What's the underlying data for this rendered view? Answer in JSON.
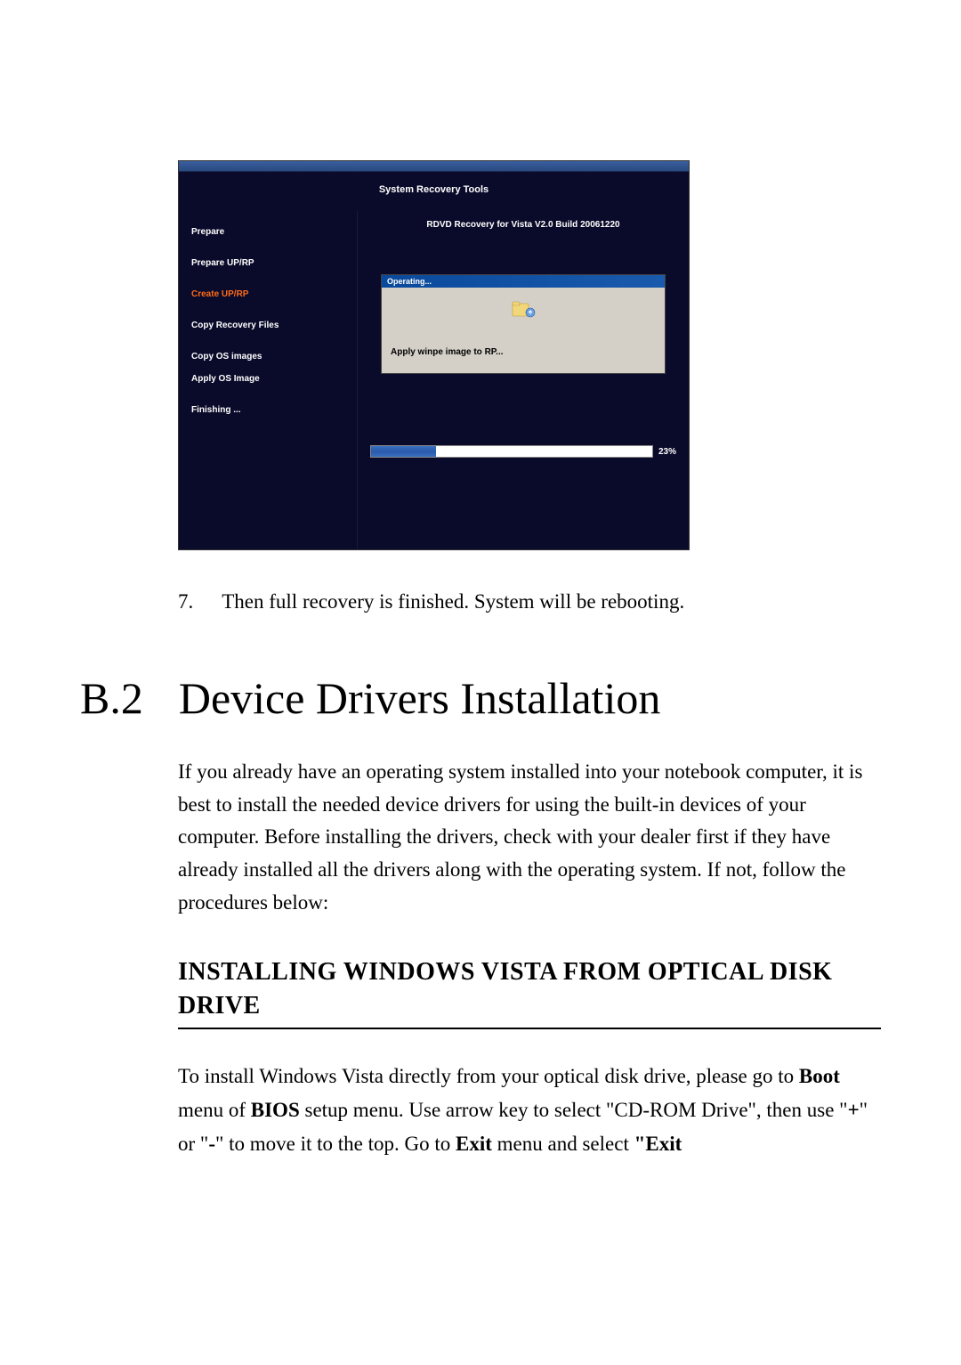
{
  "screenshot": {
    "window_title": "System Recovery Tools",
    "main_title": "RDVD Recovery for Vista V2.0 Build 20061220",
    "sidebar_steps": [
      {
        "label": "Prepare",
        "active": false
      },
      {
        "label": "Prepare UP/RP",
        "active": false
      },
      {
        "label": "Create UP/RP",
        "active": true
      },
      {
        "label": "Copy Recovery Files",
        "active": false
      },
      {
        "label": "Copy OS images",
        "active": false
      },
      {
        "label": "Apply OS Image",
        "active": false
      },
      {
        "label": "Finishing ...",
        "active": false
      }
    ],
    "dialog": {
      "title": "Operating...",
      "message": "Apply winpe image to RP..."
    },
    "progress_pct_label": "23%",
    "progress_value": 23
  },
  "step": {
    "number": "7.",
    "text": "Then full recovery is finished. System will be rebooting."
  },
  "section": {
    "number": "B.2",
    "title": "Device Drivers Installation"
  },
  "para1": "If you already have an operating system installed into your notebook computer, it is best to install the needed device drivers for using the built-in devices of your computer. Before installing the drivers, check with your dealer first if they have already installed all the drivers along with the operating system. If not, follow the procedures below:",
  "subheading": "INSTALLING WINDOWS VISTA FROM OPTICAL DISK DRIVE",
  "para2": {
    "t1": "To install Windows Vista directly from your optical disk drive, please go to ",
    "b1": "Boot",
    "t2": " menu of ",
    "b2": "BIOS",
    "t3": " setup menu. Use arrow key to select \"CD-ROM Drive\", then use \"",
    "b3": "+",
    "t4": "\" or \"",
    "b4": "-",
    "t5": "\" to move it to the top. Go to ",
    "b5": "Exit",
    "t6": " menu and select ",
    "b6": "\"Exit"
  }
}
